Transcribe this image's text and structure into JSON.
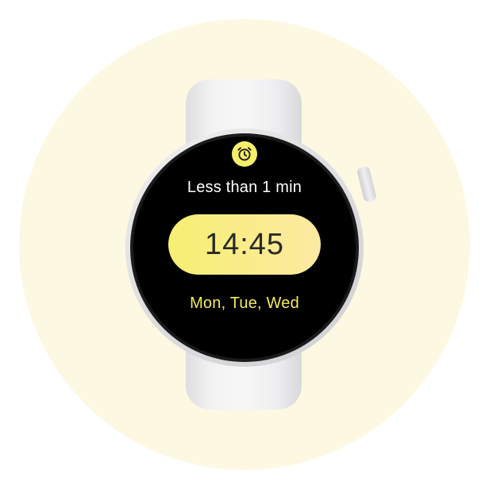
{
  "colors": {
    "backdrop": "#fdf8e2",
    "accent": "#f7ef6a",
    "chip_start": "#f6ef72",
    "chip_end": "#fde9a3",
    "days_text": "#f3ec5c",
    "screen": "#000000"
  },
  "alarm": {
    "icon": "alarm-clock-icon",
    "remaining_text": "Less than 1 min",
    "time": "14:45",
    "days": "Mon, Tue, Wed"
  }
}
